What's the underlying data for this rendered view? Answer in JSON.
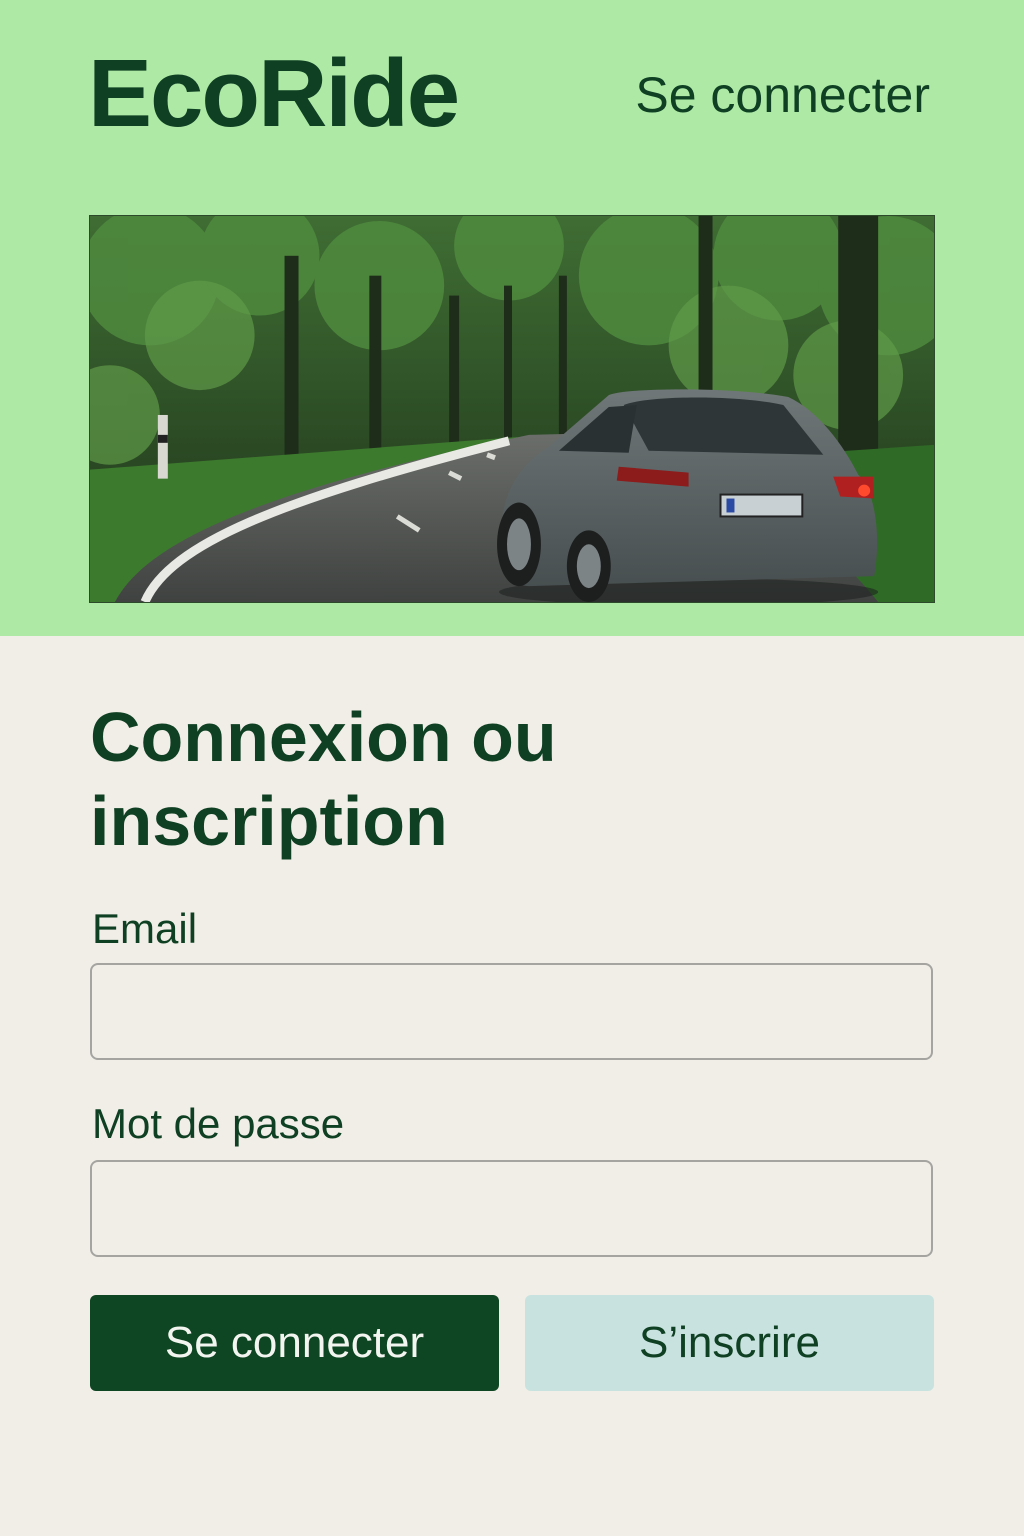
{
  "header": {
    "brand": "EcoRide",
    "login_link": "Se connecter"
  },
  "hero": {
    "image": "car-on-forest-road"
  },
  "form": {
    "title": "Connexion ou inscription",
    "email_label": "Email",
    "email_value": "",
    "password_label": "Mot de passe",
    "password_value": "",
    "login_button": "Se connecter",
    "signup_button": "S’inscrire"
  },
  "colors": {
    "header_bg": "#aeeaa6",
    "page_bg": "#f1eee7",
    "primary": "#0e4522",
    "secondary_button": "#c8e3df",
    "text": "#0f4023"
  }
}
